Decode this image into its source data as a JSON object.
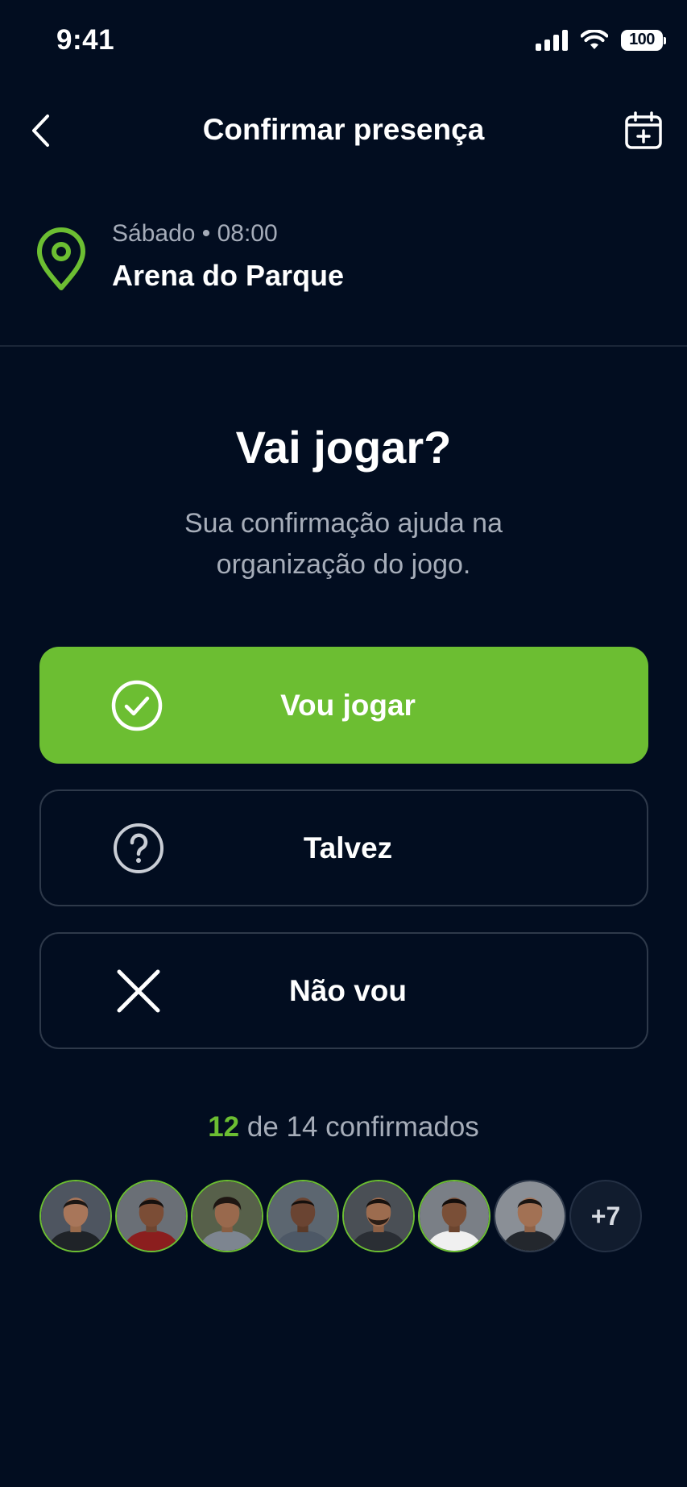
{
  "status_bar": {
    "time": "9:41",
    "battery": "100"
  },
  "header": {
    "title": "Confirmar presença",
    "back_icon": "chevron-left-icon",
    "action_icon": "calendar-plus-icon"
  },
  "event": {
    "datetime": "Sábado • 08:00",
    "venue": "Arena do Parque",
    "icon": "map-pin-icon"
  },
  "question": {
    "title": "Vai jogar?",
    "subtitle": "Sua confirmação ajuda na organização do jogo."
  },
  "options": [
    {
      "label": "Vou jogar",
      "icon": "check-circle-icon",
      "selected": true
    },
    {
      "label": "Talvez",
      "icon": "question-circle-icon",
      "selected": false
    },
    {
      "label": "Não vou",
      "icon": "x-icon",
      "selected": false
    }
  ],
  "attendance": {
    "confirmed": "12",
    "rest": "de 14 confirmados",
    "more_count": "+7"
  },
  "colors": {
    "background": "#020d20",
    "accent": "#6cbe32",
    "muted_text": "#a6adb9",
    "border": "#2e394a"
  }
}
